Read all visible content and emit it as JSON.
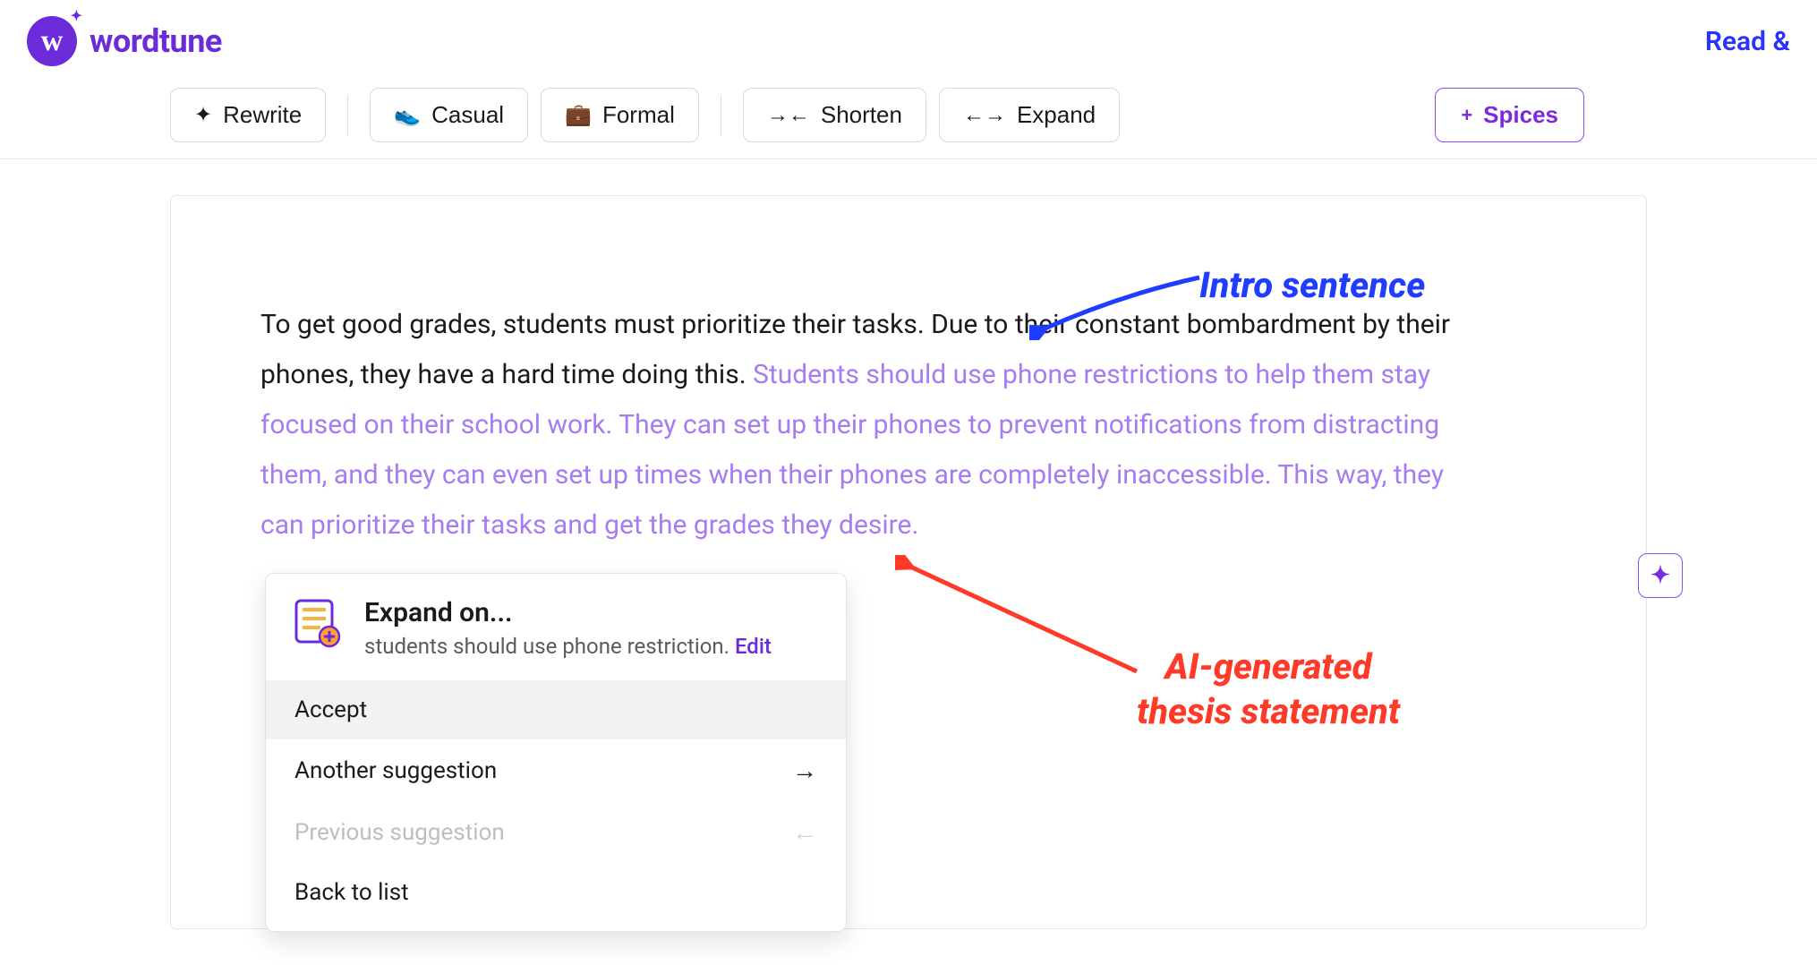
{
  "brand": {
    "name": "wordtune",
    "mark_glyph": "w"
  },
  "header": {
    "read_link": "Read & "
  },
  "toolbar": {
    "rewrite": "Rewrite",
    "casual": "Casual",
    "formal": "Formal",
    "shorten": "Shorten",
    "expand": "Expand",
    "spices": "Spices"
  },
  "document": {
    "user_text": "To get good grades, students must prioritize their tasks.  Due to their constant bombardment by their phones, they have a hard time doing this. ",
    "ai_text": "Students should use phone restrictions to help them stay focused on their school work. They can set up their phones to prevent notifications from distracting them, and they can even set up times when their phones are completely inaccessible. This way, they can prioritize their tasks and get the grades they desire."
  },
  "popover": {
    "title": "Expand on...",
    "subtitle_text": "students should use phone restriction. ",
    "edit_label": "Edit",
    "items": {
      "accept": "Accept",
      "another": "Another suggestion",
      "previous": "Previous suggestion",
      "back": "Back to list"
    }
  },
  "annotations": {
    "intro": "Intro sentence",
    "ai_line1": "AI-generated",
    "ai_line2": "thesis statement"
  },
  "glyphs": {
    "plus": "+",
    "sparkle_plus": "✦",
    "arrow_right": "→",
    "arrow_left": "←"
  }
}
